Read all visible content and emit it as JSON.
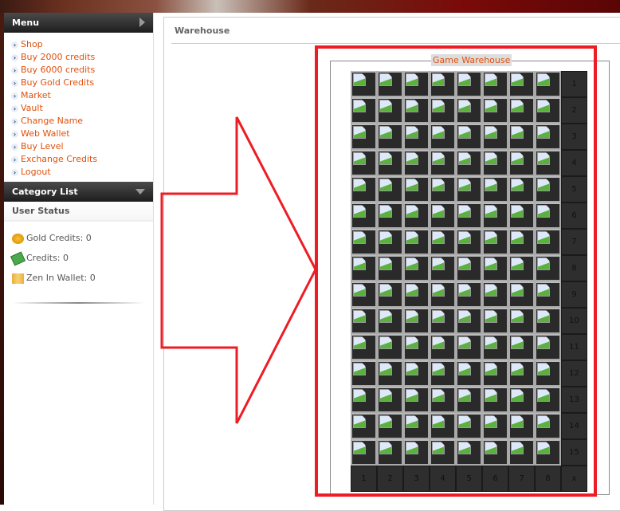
{
  "sidebar": {
    "menu_title": "Menu",
    "menu_items": [
      "Shop",
      "Buy 2000 credits",
      "Buy 6000 credits",
      "Buy Gold Credits",
      "Market",
      "Vault",
      "Change Name",
      "Web Wallet",
      "Buy Level",
      "Exchange Credits",
      "Logout"
    ],
    "category_title": "Category List",
    "user_status_title": "User Status",
    "stats": [
      {
        "icon": "gold-coin-icon",
        "label": "Gold Credits: 0"
      },
      {
        "icon": "credits-bill-icon",
        "label": "Credits: 0"
      },
      {
        "icon": "zen-coins-icon",
        "label": "Zen In Wallet: 0"
      }
    ]
  },
  "main": {
    "title": "Warehouse",
    "warehouse_legend": "Game Warehouse",
    "rows": 15,
    "cols": 8,
    "corner_label": "x"
  },
  "colors": {
    "link": "#e0500c",
    "annotation": "#ee1c25"
  }
}
